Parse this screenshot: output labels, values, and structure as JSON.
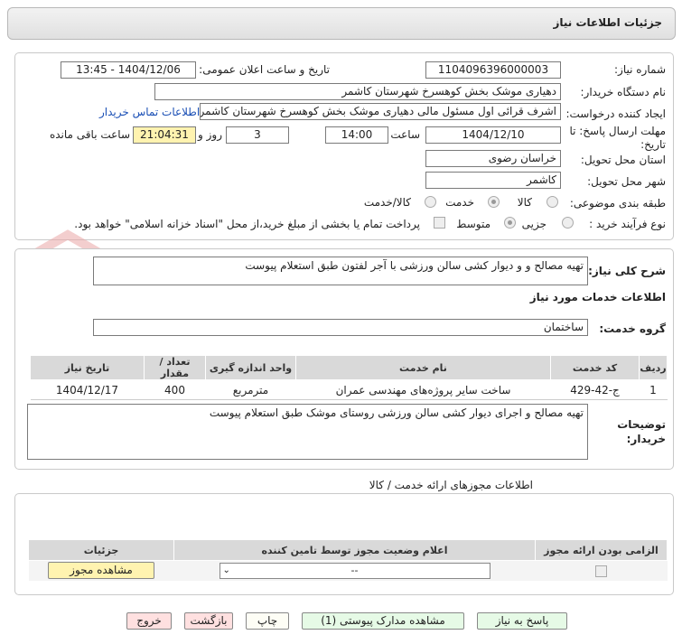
{
  "header": {
    "title": "جزئیات اطلاعات نیاز"
  },
  "info": {
    "need_number_label": "شماره نیاز:",
    "need_number": "1104096396000003",
    "announce_label": "تاریخ و ساعت اعلان عمومی:",
    "announce_value": "1404/12/06 - 13:45",
    "buyer_org_label": "نام دستگاه خریدار:",
    "buyer_org": "دهیاری موشک بخش کوهسرخ شهرستان کاشمر",
    "requester_label": "ایجاد کننده درخواست:",
    "requester": "اشرف قرائی اول مسئول مالی دهیاری موشک بخش کوهسرخ شهرستان کاشمر",
    "contact_link": "اطلاعات تماس خریدار",
    "deadline_label": "مهلت ارسال پاسخ: تا تاریخ:",
    "deadline_date": "1404/12/10",
    "time_label": "ساعت",
    "deadline_time": "14:00",
    "days_value": "3",
    "days_label": "روز و",
    "remaining_time": "21:04:31",
    "remaining_label": "ساعت باقی مانده",
    "province_label": "استان محل تحویل:",
    "province": "خراسان رضوی",
    "city_label": "شهر محل تحویل:",
    "city": "کاشمر",
    "category_label": "طبقه بندی موضوعی:",
    "category_options": [
      "کالا",
      "خدمت",
      "کالا/خدمت"
    ],
    "process_label": "نوع فرآیند خرید :",
    "process_options": [
      "جزیی",
      "متوسط"
    ],
    "payment_note": "پرداخت تمام یا بخشی از مبلغ خرید،از محل \"اسناد خزانه اسلامی\" خواهد بود."
  },
  "need": {
    "general_label": "شرح کلی نیاز:",
    "general_desc": "تهیه مصالح و و دیوار کشی سالن ورزشی با آجر لفتون طبق استعلام پیوست",
    "services_title": "اطلاعات خدمات مورد نیاز",
    "group_label": "گروه خدمت:",
    "group_value": "ساختمان"
  },
  "services_table": {
    "headers": [
      "ردیف",
      "کد خدمت",
      "نام خدمت",
      "واحد اندازه گیری",
      "تعداد / مقدار",
      "تاریخ نیاز"
    ],
    "rows": [
      [
        "1",
        "ج-42-429",
        "ساخت سایر پروژه‌های مهندسی عمران",
        "مترمربع",
        "400",
        "1404/12/17"
      ]
    ]
  },
  "buyer_notes": {
    "label": "توضیحات خریدار:",
    "text": "تهیه مصالح و اجرای دیوار کشی سالن ورزشی روستای موشک طبق استعلام پیوست"
  },
  "licenses": {
    "title": "اطلاعات مجوزهای ارائه خدمت / کالا",
    "headers": [
      "الزامی بودن ارائه مجوز",
      "اعلام وضعیت مجوز توسط تامین کننده",
      "جزئیات"
    ],
    "select_value": "--",
    "view_button": "مشاهده مجوز"
  },
  "footer": {
    "reply": "پاسخ به نیاز",
    "docs": "مشاهده مدارک پیوستی (1)",
    "print": "چاپ",
    "back": "بازگشت",
    "exit": "خروج"
  },
  "watermark": {
    "text": "AriaTender.neT"
  },
  "colors": {
    "link": "#1a4fb5",
    "watermark": "#e08080",
    "yellow": "#fff3b0"
  }
}
